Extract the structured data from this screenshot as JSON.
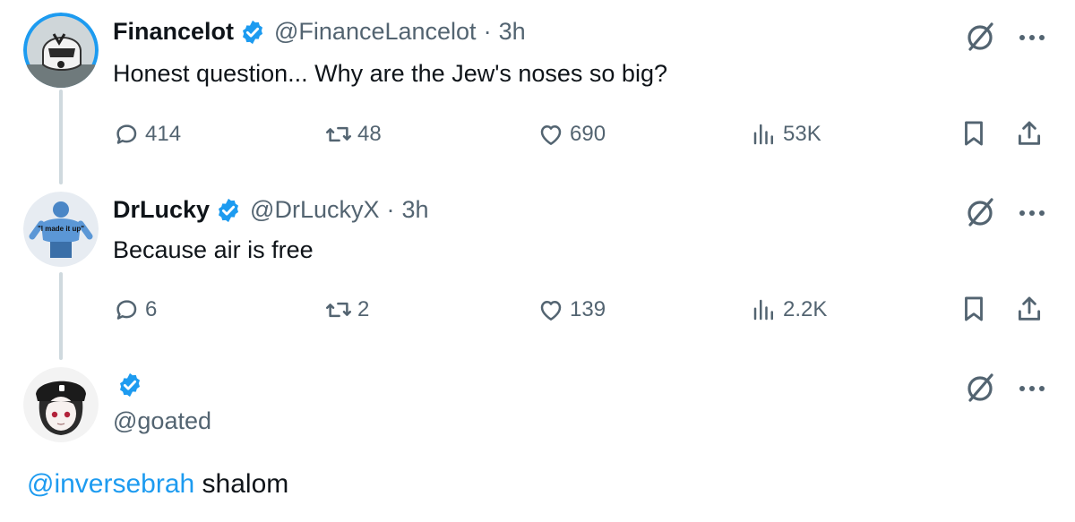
{
  "colors": {
    "accent": "#1d9bf0",
    "text": "#0f1419",
    "muted": "#536471",
    "thread_line": "#cfd9de"
  },
  "tweets": [
    {
      "display_name": "Financelot",
      "handle": "@FinanceLancelot",
      "separator": "·",
      "time": "3h",
      "text": "Honest question... Why are the Jew's noses so big?",
      "replies": "414",
      "reposts": "48",
      "likes": "690",
      "views": "53K",
      "avatar_icon": "motorcycle-helmet-avatar"
    },
    {
      "display_name": "DrLucky",
      "handle": "@DrLuckyX",
      "separator": "·",
      "time": "3h",
      "text": "Because air is free",
      "replies": "6",
      "reposts": "2",
      "likes": "139",
      "views": "2.2K",
      "avatar_icon": "blue-muscle-man-avatar",
      "avatar_caption": "\"I made it up\""
    }
  ],
  "reply": {
    "handle": "@goated",
    "mention": "@inversebrah",
    "text": " shalom",
    "avatar_icon": "anime-girl-avatar"
  }
}
